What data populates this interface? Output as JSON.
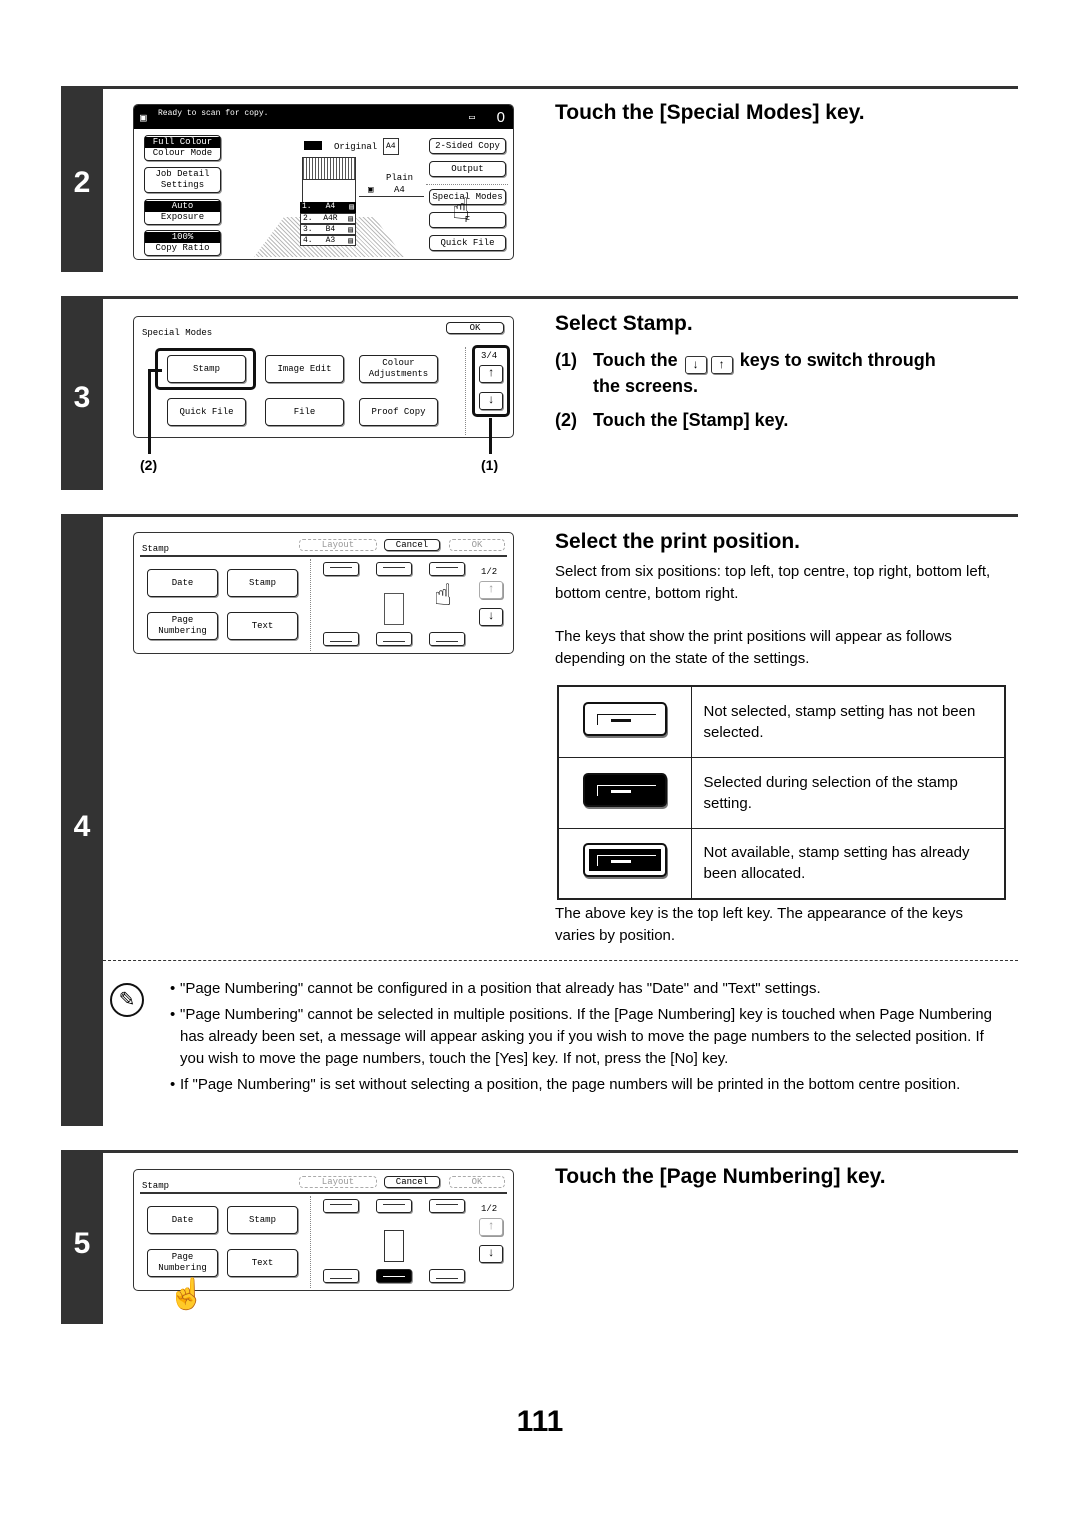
{
  "page_number": "111",
  "steps": [
    {
      "number": "2",
      "heading": "Touch the [Special Modes] key.",
      "screen": {
        "status": "Ready to scan for copy.",
        "copy_count": "0",
        "left_buttons": [
          {
            "top": "Full Colour",
            "bottom": "Colour Mode"
          },
          {
            "top": "Job Detail",
            "bottom": "Settings"
          },
          {
            "top": "Auto",
            "bottom": "Exposure"
          },
          {
            "top": "100%",
            "bottom": "Copy Ratio"
          }
        ],
        "original_label": "Original",
        "original_size": "A4",
        "paper_type": "Plain",
        "paper_size": "A4",
        "trays": [
          {
            "index": "1.",
            "size": "A4"
          },
          {
            "index": "2.",
            "size": "A4R"
          },
          {
            "index": "3.",
            "size": "B4"
          },
          {
            "index": "4.",
            "size": "A3"
          }
        ],
        "right_buttons": [
          "2-Sided Copy",
          "Output",
          "Special Modes",
          "F",
          "Quick File"
        ]
      }
    },
    {
      "number": "3",
      "heading": "Select Stamp.",
      "substeps": [
        {
          "num": "(1)",
          "text_before": "Touch the",
          "key1": "↓",
          "key2": "↑",
          "text_after": "keys to switch through",
          "text_cont": "the screens."
        },
        {
          "num": "(2)",
          "text": "Touch the [Stamp] key."
        }
      ],
      "screen": {
        "title": "Special Modes",
        "ok": "OK",
        "page": "3/4",
        "buttons": [
          "Stamp",
          "Image Edit",
          "Colour Adjustments",
          "Quick File",
          "File",
          "Proof Copy"
        ],
        "up": "↑",
        "down": "↓"
      },
      "callouts": [
        "(2)",
        "(1)"
      ]
    },
    {
      "number": "4",
      "heading": "Select the print position.",
      "para1": "Select from six positions: top left, top centre, top right, bottom left, bottom centre, bottom right.",
      "para2": "The keys that show the print positions will appear as follows depending on the state of the settings.",
      "key_states": [
        {
          "state": "not-selected",
          "text": "Not selected, stamp setting has not been selected."
        },
        {
          "state": "selected",
          "text": "Selected during selection of the stamp setting."
        },
        {
          "state": "not-available",
          "text": "Not available, stamp setting has already been allocated."
        }
      ],
      "after_table": "The above key is the top left key. The appearance of the keys varies by position.",
      "screen": {
        "title": "Stamp",
        "layout": "Layout",
        "cancel": "Cancel",
        "ok": "OK",
        "page": "1/2",
        "buttons": [
          "Date",
          "Stamp",
          "Page Numbering",
          "Text"
        ]
      },
      "notes": [
        "\"Page Numbering\" cannot be configured in a position that already has \"Date\" and \"Text\" settings.",
        "\"Page Numbering\" cannot be selected in multiple positions. If the [Page Numbering] key is touched when Page Numbering has already been set, a message will appear asking you if you wish to move the page numbers to the selected position. If you wish to move the page numbers, touch the [Yes] key. If not, press the [No] key.",
        "If \"Page Numbering\" is set without selecting a position, the page numbers will be printed in the bottom centre position."
      ]
    },
    {
      "number": "5",
      "heading": "Touch the [Page Numbering] key.",
      "screen": {
        "title": "Stamp",
        "layout": "Layout",
        "cancel": "Cancel",
        "ok": "OK",
        "page": "1/2",
        "buttons": [
          "Date",
          "Stamp",
          "Page Numbering",
          "Text"
        ],
        "selected_position": "bottom centre"
      }
    }
  ],
  "icons": {
    "hand": "☝",
    "note": "✎",
    "up": "↑",
    "down": "↓"
  }
}
